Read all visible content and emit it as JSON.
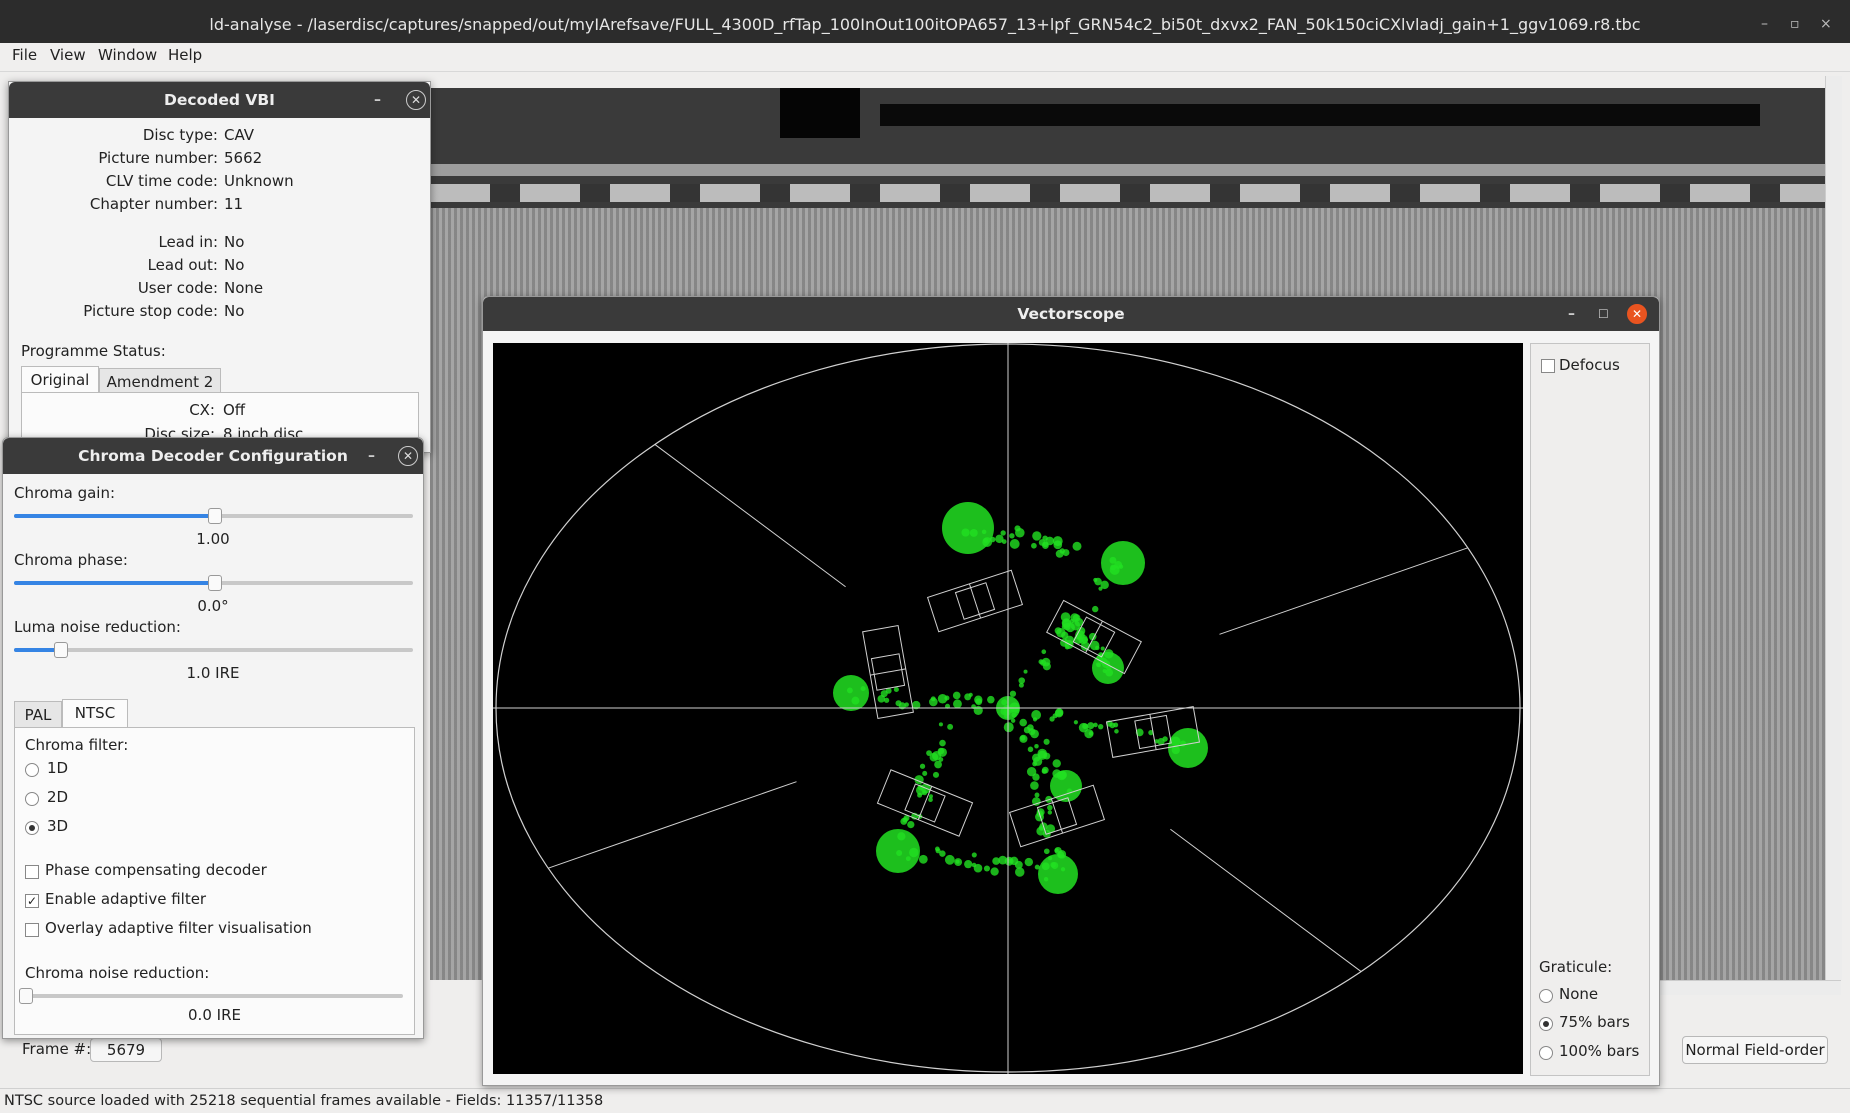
{
  "window": {
    "title": "ld-analyse - /laserdisc/captures/snapped/out/myIArefsave/FULL_4300D_rfTap_100InOut100itOPA657_13+lpf_GRN54c2_bi50t_dxvx2_FAN_50k150ciCXlvladj_gain+1_ggv1069.r8.tbc",
    "minimize": "–",
    "maximize": "▫",
    "close": "×"
  },
  "menu": [
    "File",
    "View",
    "Window",
    "Help"
  ],
  "vbi": {
    "title": "Decoded VBI",
    "rows": [
      {
        "label": "Disc type:",
        "value": "CAV"
      },
      {
        "label": "Picture number:",
        "value": "5662"
      },
      {
        "label": "CLV time code:",
        "value": "Unknown"
      },
      {
        "label": "Chapter number:",
        "value": "11"
      },
      {
        "label": "Lead in:",
        "value": "No"
      },
      {
        "label": "Lead out:",
        "value": "No"
      },
      {
        "label": "User code:",
        "value": "None"
      },
      {
        "label": "Picture stop code:",
        "value": "No"
      }
    ],
    "programme_status": "Programme Status:",
    "tabs": [
      "Original",
      "Amendment 2"
    ],
    "cx_label": "CX:",
    "cx_value": "Off",
    "disc_size_label": "Disc size:",
    "disc_size_value": "8 inch disc"
  },
  "chroma": {
    "title": "Chroma Decoder Configuration",
    "gain_label": "Chroma gain:",
    "gain_value": "1.00",
    "gain_level": 0.5,
    "phase_label": "Chroma phase:",
    "phase_value": "0.0°",
    "phase_level": 0.5,
    "luma_label": "Luma noise reduction:",
    "luma_value": "1.0 IRE",
    "luma_level": 0.115,
    "tabs": [
      "PAL",
      "NTSC"
    ],
    "filter_label": "Chroma filter:",
    "filter_options": [
      "1D",
      "2D",
      "3D"
    ],
    "filter_selected": "3D",
    "phase_comp": "Phase compensating decoder",
    "adaptive": "Enable adaptive filter",
    "overlay": "Overlay adaptive filter visualisation",
    "noise_label": "Chroma noise reduction:",
    "noise_value": "0.0 IRE",
    "noise_level": 0.0
  },
  "vectorscope": {
    "title": "Vectorscope",
    "defocus": "Defocus",
    "graticule_label": "Graticule:",
    "graticule_options": [
      "None",
      "75% bars",
      "100% bars"
    ],
    "graticule_selected": "75% bars"
  },
  "bottom": {
    "frame_label": "Frame #:",
    "frame_value": "5679",
    "field_order_button": "Normal Field-order"
  },
  "status": "NTSC source loaded with 25218 sequential frames available  -  Fields: 11357/11358",
  "colors": {
    "trace": "#22e022",
    "graticule": "#d0d0d0",
    "accent": "#3584e4",
    "close_red": "#e95420"
  }
}
